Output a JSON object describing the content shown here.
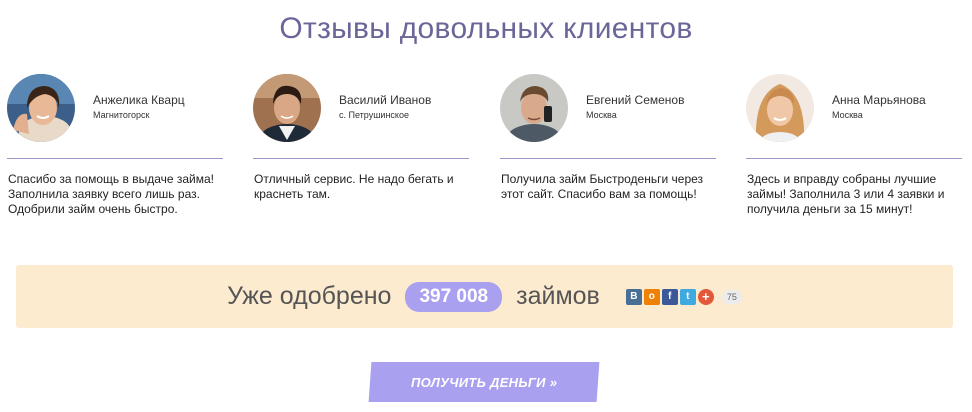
{
  "section_title": "Отзывы довольных клиентов",
  "reviews": [
    {
      "name": "Анжелика Кварц",
      "city": "Магнитогорск",
      "text": "Спасибо за помощь в выдаче займа! Заполнила заявку всего лишь раз. Одобрили займ очень быстро."
    },
    {
      "name": "Василий Иванов",
      "city": "с. Петрушинское",
      "text": "Отличный сервис. Не надо бегать и краснеть там."
    },
    {
      "name": "Евгений Семенов",
      "city": "Москва",
      "text": "Получила займ Быстроденьги через этот сайт. Спасибо вам за помощь!"
    },
    {
      "name": "Анна Марьянова",
      "city": "Москва",
      "text": "Здесь и вправду собраны лучшие займы! Заполнила 3 или 4 заявки и получила деньги за 15 минут!"
    }
  ],
  "banner": {
    "prefix": "Уже одобрено",
    "count": "397 008",
    "suffix": "займов",
    "share_count": "75",
    "social": [
      {
        "icon": "vk-icon",
        "glyph": "В",
        "color": "#4a6f96"
      },
      {
        "icon": "odnoklassniki-icon",
        "glyph": "о",
        "color": "#ee8208"
      },
      {
        "icon": "facebook-icon",
        "glyph": "f",
        "color": "#3b5998"
      },
      {
        "icon": "twitter-icon",
        "glyph": "t",
        "color": "#3fa9e0"
      },
      {
        "icon": "more-share-icon",
        "glyph": "+",
        "color": "#e4583a"
      }
    ]
  },
  "cta_label": "ПОЛУЧИТЬ ДЕНЬГИ »",
  "colors": {
    "title": "#6a6697",
    "accent": "#a9a0ef",
    "banner_bg": "#fdebd0",
    "divider": "#9b97c9"
  }
}
